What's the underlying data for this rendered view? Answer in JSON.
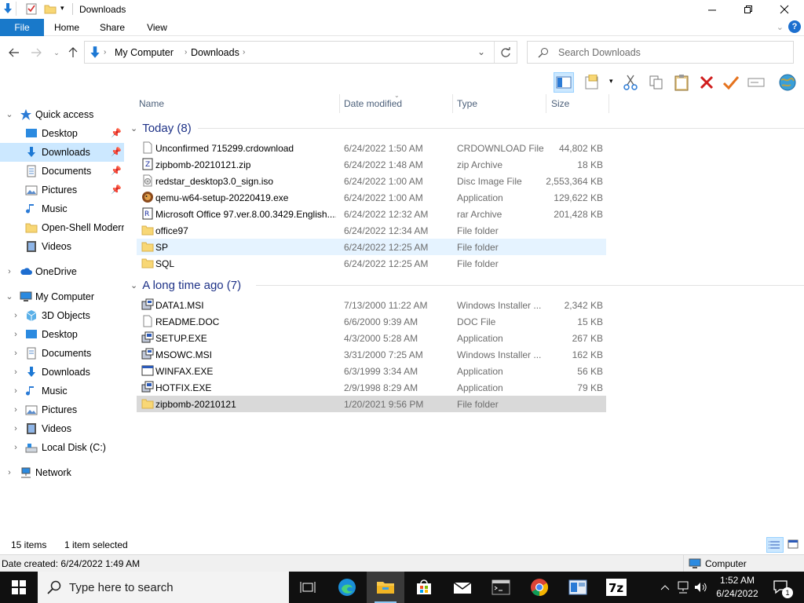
{
  "window": {
    "title": "Downloads"
  },
  "ribbon": {
    "tabs": [
      "File",
      "Home",
      "Share",
      "View"
    ]
  },
  "address": {
    "crumbs": [
      "My Computer",
      "Downloads"
    ]
  },
  "search": {
    "placeholder": "Search Downloads"
  },
  "columns": {
    "name": "Name",
    "date": "Date modified",
    "type": "Type",
    "size": "Size"
  },
  "navpane": {
    "quick_access": "Quick access",
    "quick_items": [
      "Desktop",
      "Downloads",
      "Documents",
      "Pictures",
      "Music",
      "Open-Shell Modern",
      "Videos"
    ],
    "onedrive": "OneDrive",
    "my_computer": "My Computer",
    "pc_items": [
      "3D Objects",
      "Desktop",
      "Documents",
      "Downloads",
      "Music",
      "Pictures",
      "Videos",
      "Local Disk (C:)"
    ],
    "network": "Network"
  },
  "groups": [
    {
      "label": "Today (8)",
      "files": [
        {
          "name": "Unconfirmed 715299.crdownload",
          "date": "6/24/2022 1:50 AM",
          "type": "CRDOWNLOAD File",
          "size": "44,802 KB",
          "icon": "blank-file-icon"
        },
        {
          "name": "zipbomb-20210121.zip",
          "date": "6/24/2022 1:48 AM",
          "type": "zip Archive",
          "size": "18 KB",
          "icon": "zip-archive-icon"
        },
        {
          "name": "redstar_desktop3.0_sign.iso",
          "date": "6/24/2022 1:00 AM",
          "type": "Disc Image File",
          "size": "2,553,364 KB",
          "icon": "disc-image-icon"
        },
        {
          "name": "qemu-w64-setup-20220419.exe",
          "date": "6/24/2022 1:00 AM",
          "type": "Application",
          "size": "129,622 KB",
          "icon": "qemu-app-icon"
        },
        {
          "name": "Microsoft Office 97.ver.8.00.3429.English....",
          "date": "6/24/2022 12:32 AM",
          "type": "rar Archive",
          "size": "201,428 KB",
          "icon": "rar-archive-icon"
        },
        {
          "name": "office97",
          "date": "6/24/2022 12:34 AM",
          "type": "File folder",
          "size": "",
          "icon": "folder-icon"
        },
        {
          "name": "SP",
          "date": "6/24/2022 12:25 AM",
          "type": "File folder",
          "size": "",
          "icon": "folder-icon"
        },
        {
          "name": "SQL",
          "date": "6/24/2022 12:25 AM",
          "type": "File folder",
          "size": "",
          "icon": "folder-icon"
        }
      ]
    },
    {
      "label": "A long time ago (7)",
      "files": [
        {
          "name": "DATA1.MSI",
          "date": "7/13/2000 11:22 AM",
          "type": "Windows Installer ...",
          "size": "2,342 KB",
          "icon": "installer-icon"
        },
        {
          "name": "README.DOC",
          "date": "6/6/2000 9:39 AM",
          "type": "DOC File",
          "size": "15 KB",
          "icon": "blank-file-icon"
        },
        {
          "name": "SETUP.EXE",
          "date": "4/3/2000 5:28 AM",
          "type": "Application",
          "size": "267 KB",
          "icon": "setup-app-icon"
        },
        {
          "name": "MSOWC.MSI",
          "date": "3/31/2000 7:25 AM",
          "type": "Windows Installer ...",
          "size": "162 KB",
          "icon": "installer-icon"
        },
        {
          "name": "WINFAX.EXE",
          "date": "6/3/1999 3:34 AM",
          "type": "Application",
          "size": "56 KB",
          "icon": "window-app-icon"
        },
        {
          "name": "HOTFIX.EXE",
          "date": "2/9/1998 8:29 AM",
          "type": "Application",
          "size": "79 KB",
          "icon": "setup-app-icon"
        },
        {
          "name": "zipbomb-20210121",
          "date": "1/20/2021 9:56 PM",
          "type": "File folder",
          "size": "",
          "icon": "folder-icon"
        }
      ]
    }
  ],
  "status": {
    "count": "15 items",
    "selected": "1 item selected",
    "date_created": "Date created: 6/24/2022 1:49 AM",
    "location": "Computer"
  },
  "taskbar": {
    "search_placeholder": "Type here to search",
    "time": "1:52 AM",
    "date": "6/24/2022",
    "notifications": "1"
  },
  "colors": {
    "accent": "#1979ca",
    "selection": "#cce8ff",
    "group_header": "#1e3287",
    "taskbar": "#101010"
  }
}
